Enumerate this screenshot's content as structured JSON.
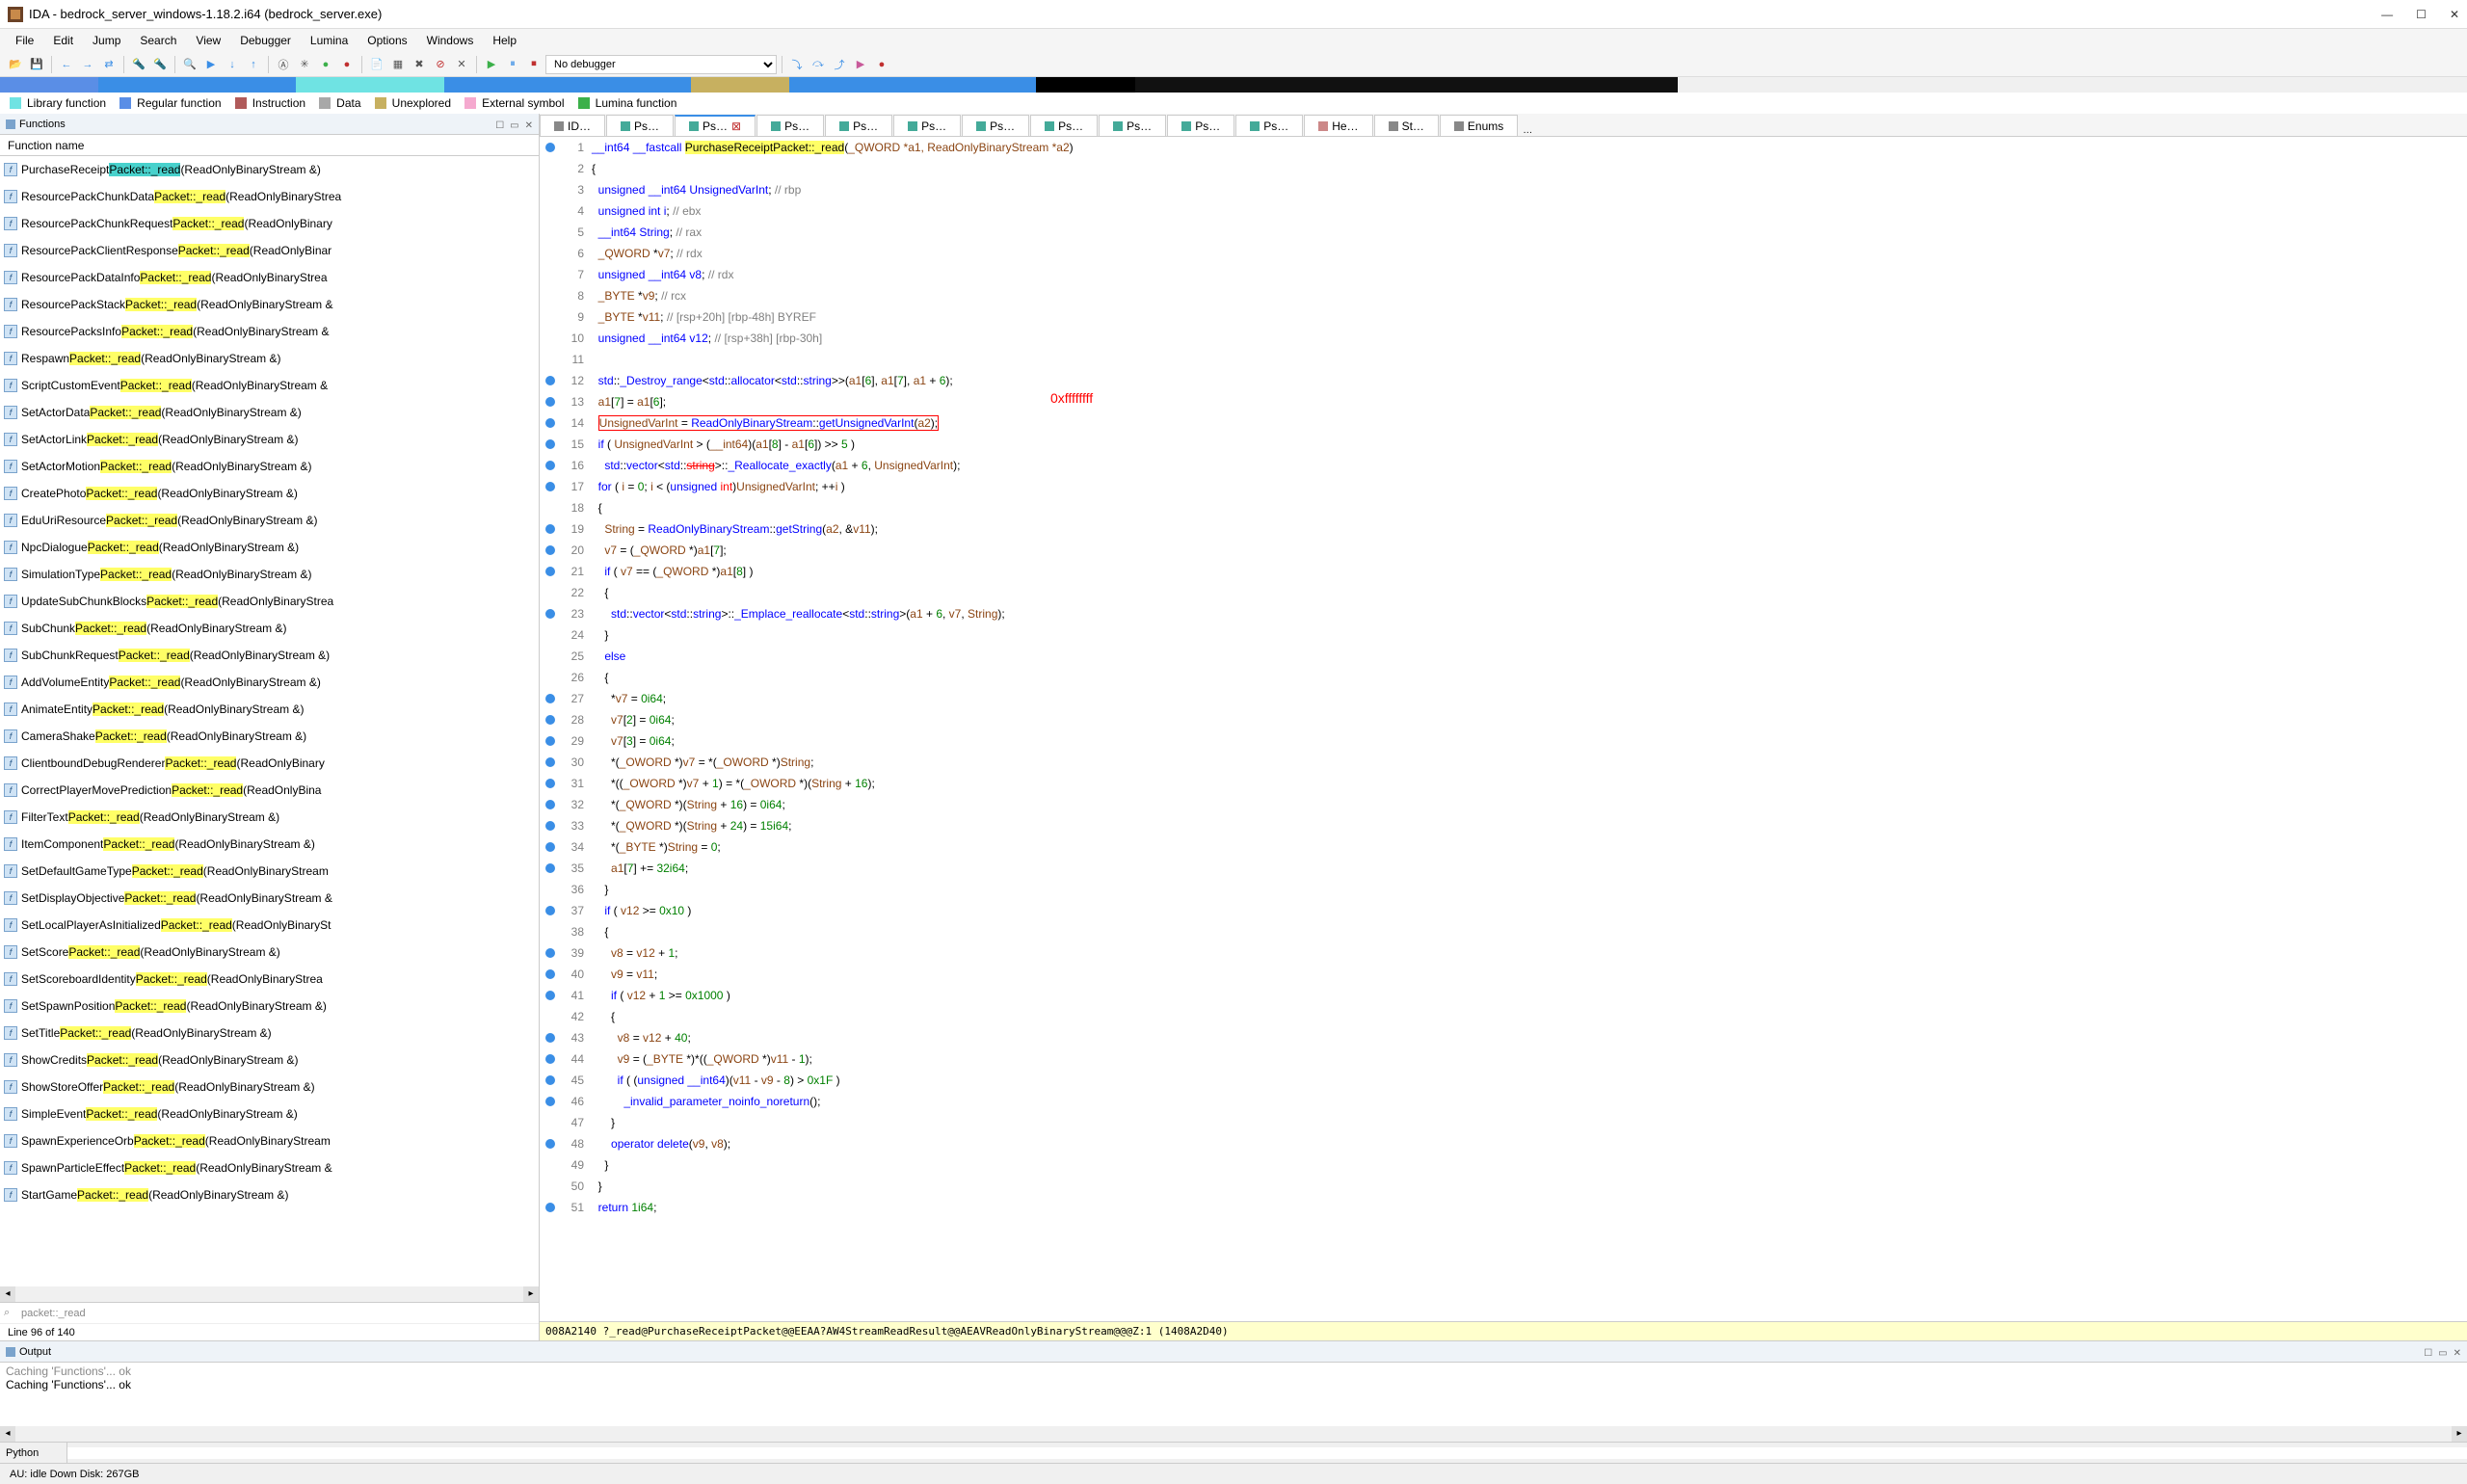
{
  "window": {
    "title": "IDA - bedrock_server_windows-1.18.2.i64 (bedrock_server.exe)",
    "min": "—",
    "max": "☐",
    "close": "✕"
  },
  "menu": [
    "File",
    "Edit",
    "Jump",
    "Search",
    "View",
    "Debugger",
    "Lumina",
    "Options",
    "Windows",
    "Help"
  ],
  "debugger_combo": "No debugger",
  "legend": [
    {
      "color": "#6fe3e3",
      "label": "Library function"
    },
    {
      "color": "#5a8ee6",
      "label": "Regular function"
    },
    {
      "color": "#b05a5a",
      "label": "Instruction"
    },
    {
      "color": "#a8a8a8",
      "label": "Data"
    },
    {
      "color": "#c7b060",
      "label": "Unexplored"
    },
    {
      "color": "#f5a9cf",
      "label": "External symbol"
    },
    {
      "color": "#3cb04a",
      "label": "Lumina function"
    }
  ],
  "functions": {
    "panel_title": "Functions",
    "col": "Function name",
    "search": "packet::_read",
    "status": "Line 96 of 140",
    "items": [
      {
        "pre": "PurchaseReceipt",
        "hl": "Packet::_read",
        "hlclass": "hl2",
        "post": "(ReadOnlyBinaryStream &)"
      },
      {
        "pre": "ResourcePackChunkData",
        "hl": "Packet::_read",
        "hlclass": "hl1",
        "post": "(ReadOnlyBinaryStrea"
      },
      {
        "pre": "ResourcePackChunkRequest",
        "hl": "Packet::_read",
        "hlclass": "hl1",
        "post": "(ReadOnlyBinary"
      },
      {
        "pre": "ResourcePackClientResponse",
        "hl": "Packet::_read",
        "hlclass": "hl1",
        "post": "(ReadOnlyBinar"
      },
      {
        "pre": "ResourcePackDataInfo",
        "hl": "Packet::_read",
        "hlclass": "hl1",
        "post": "(ReadOnlyBinaryStrea"
      },
      {
        "pre": "ResourcePackStack",
        "hl": "Packet::_read",
        "hlclass": "hl1",
        "post": "(ReadOnlyBinaryStream &"
      },
      {
        "pre": "ResourcePacksInfo",
        "hl": "Packet::_read",
        "hlclass": "hl1",
        "post": "(ReadOnlyBinaryStream &"
      },
      {
        "pre": "Respawn",
        "hl": "Packet::_read",
        "hlclass": "hl1",
        "post": "(ReadOnlyBinaryStream &)"
      },
      {
        "pre": "ScriptCustomEvent",
        "hl": "Packet::_read",
        "hlclass": "hl1",
        "post": "(ReadOnlyBinaryStream &"
      },
      {
        "pre": "SetActorData",
        "hl": "Packet::_read",
        "hlclass": "hl1",
        "post": "(ReadOnlyBinaryStream &)"
      },
      {
        "pre": "SetActorLink",
        "hl": "Packet::_read",
        "hlclass": "hl1",
        "post": "(ReadOnlyBinaryStream &)"
      },
      {
        "pre": "SetActorMotion",
        "hl": "Packet::_read",
        "hlclass": "hl1",
        "post": "(ReadOnlyBinaryStream &)"
      },
      {
        "pre": "CreatePhoto",
        "hl": "Packet::_read",
        "hlclass": "hl1",
        "post": "(ReadOnlyBinaryStream &)"
      },
      {
        "pre": "EduUriResource",
        "hl": "Packet::_read",
        "hlclass": "hl1",
        "post": "(ReadOnlyBinaryStream &)"
      },
      {
        "pre": "NpcDialogue",
        "hl": "Packet::_read",
        "hlclass": "hl1",
        "post": "(ReadOnlyBinaryStream &)"
      },
      {
        "pre": "SimulationType",
        "hl": "Packet::_read",
        "hlclass": "hl1",
        "post": "(ReadOnlyBinaryStream &)"
      },
      {
        "pre": "UpdateSubChunkBlocks",
        "hl": "Packet::_read",
        "hlclass": "hl1",
        "post": "(ReadOnlyBinaryStrea"
      },
      {
        "pre": "SubChunk",
        "hl": "Packet::_read",
        "hlclass": "hl1",
        "post": "(ReadOnlyBinaryStream &)"
      },
      {
        "pre": "SubChunkRequest",
        "hl": "Packet::_read",
        "hlclass": "hl1",
        "post": "(ReadOnlyBinaryStream &)"
      },
      {
        "pre": "AddVolumeEntity",
        "hl": "Packet::_read",
        "hlclass": "hl1",
        "post": "(ReadOnlyBinaryStream &)"
      },
      {
        "pre": "AnimateEntity",
        "hl": "Packet::_read",
        "hlclass": "hl1",
        "post": "(ReadOnlyBinaryStream &)"
      },
      {
        "pre": "CameraShake",
        "hl": "Packet::_read",
        "hlclass": "hl1",
        "post": "(ReadOnlyBinaryStream &)"
      },
      {
        "pre": "ClientboundDebugRenderer",
        "hl": "Packet::_read",
        "hlclass": "hl1",
        "post": "(ReadOnlyBinary"
      },
      {
        "pre": "CorrectPlayerMovePrediction",
        "hl": "Packet::_read",
        "hlclass": "hl1",
        "post": "(ReadOnlyBina"
      },
      {
        "pre": "FilterText",
        "hl": "Packet::_read",
        "hlclass": "hl1",
        "post": "(ReadOnlyBinaryStream &)"
      },
      {
        "pre": "ItemComponent",
        "hl": "Packet::_read",
        "hlclass": "hl1",
        "post": "(ReadOnlyBinaryStream &)"
      },
      {
        "pre": "SetDefaultGameType",
        "hl": "Packet::_read",
        "hlclass": "hl1",
        "post": "(ReadOnlyBinaryStream"
      },
      {
        "pre": "SetDisplayObjective",
        "hl": "Packet::_read",
        "hlclass": "hl1",
        "post": "(ReadOnlyBinaryStream &"
      },
      {
        "pre": "SetLocalPlayerAsInitialized",
        "hl": "Packet::_read",
        "hlclass": "hl1",
        "post": "(ReadOnlyBinarySt"
      },
      {
        "pre": "SetScore",
        "hl": "Packet::_read",
        "hlclass": "hl1",
        "post": "(ReadOnlyBinaryStream &)"
      },
      {
        "pre": "SetScoreboardIdentity",
        "hl": "Packet::_read",
        "hlclass": "hl1",
        "post": "(ReadOnlyBinaryStrea"
      },
      {
        "pre": "SetSpawnPosition",
        "hl": "Packet::_read",
        "hlclass": "hl1",
        "post": "(ReadOnlyBinaryStream &)"
      },
      {
        "pre": "SetTitle",
        "hl": "Packet::_read",
        "hlclass": "hl1",
        "post": "(ReadOnlyBinaryStream &)"
      },
      {
        "pre": "ShowCredits",
        "hl": "Packet::_read",
        "hlclass": "hl1",
        "post": "(ReadOnlyBinaryStream &)"
      },
      {
        "pre": "ShowStoreOffer",
        "hl": "Packet::_read",
        "hlclass": "hl1",
        "post": "(ReadOnlyBinaryStream &)"
      },
      {
        "pre": "SimpleEvent",
        "hl": "Packet::_read",
        "hlclass": "hl1",
        "post": "(ReadOnlyBinaryStream &)"
      },
      {
        "pre": "SpawnExperienceOrb",
        "hl": "Packet::_read",
        "hlclass": "hl1",
        "post": "(ReadOnlyBinaryStream"
      },
      {
        "pre": "SpawnParticleEffect",
        "hl": "Packet::_read",
        "hlclass": "hl1",
        "post": "(ReadOnlyBinaryStream &"
      },
      {
        "pre": "StartGame",
        "hl": "Packet::_read",
        "hlclass": "hl1",
        "post": "(ReadOnlyBinaryStream &)"
      }
    ]
  },
  "tabs": [
    {
      "label": "ID…",
      "icon": "#888"
    },
    {
      "label": "Ps…",
      "icon": "#4a9"
    },
    {
      "label": "Ps…",
      "icon": "#4a9",
      "close": true
    },
    {
      "label": "Ps…",
      "icon": "#4a9"
    },
    {
      "label": "Ps…",
      "icon": "#4a9"
    },
    {
      "label": "Ps…",
      "icon": "#4a9"
    },
    {
      "label": "Ps…",
      "icon": "#4a9"
    },
    {
      "label": "Ps…",
      "icon": "#4a9"
    },
    {
      "label": "Ps…",
      "icon": "#4a9"
    },
    {
      "label": "Ps…",
      "icon": "#4a9"
    },
    {
      "label": "Ps…",
      "icon": "#4a9"
    },
    {
      "label": "He…",
      "icon": "#c88"
    },
    {
      "label": "St…",
      "icon": "#888"
    },
    {
      "label": "Enums",
      "icon": "#888"
    }
  ],
  "code_path": "008A2140 ?_read@PurchaseReceiptPacket@@EEAA?AW4StreamReadResult@@AEAVReadOnlyBinaryStream@@@Z:1 (1408A2D40)",
  "annotation": "0xffffffff",
  "output": {
    "panel_title": "Output",
    "lines": [
      "Caching 'Functions'... ok",
      "Caching 'Functions'... ok"
    ]
  },
  "python_label": "Python",
  "statusbar": "AU:  idle   Down    Disk: 267GB"
}
